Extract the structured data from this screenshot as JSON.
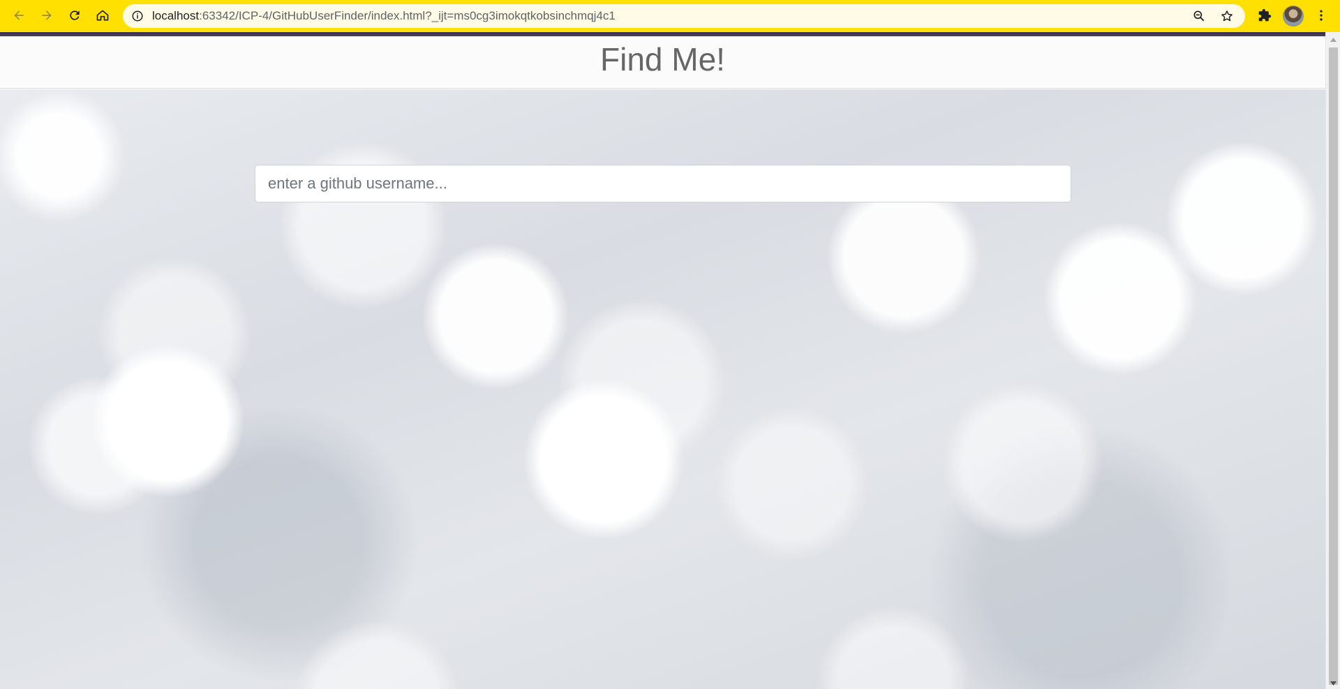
{
  "browser": {
    "url_host": "localhost",
    "url_rest": ":63342/ICP-4/GitHubUserFinder/index.html?_ijt=ms0cg3imokqtkobsinchmqj4c1",
    "toolbar_color": "#ffe000"
  },
  "page": {
    "brand": "Find Me!",
    "search": {
      "placeholder": "enter a github username...",
      "value": ""
    }
  },
  "icons": {
    "back": "arrow-left-icon",
    "forward": "arrow-right-icon",
    "reload": "reload-icon",
    "home": "home-icon",
    "info": "info-icon",
    "zoom": "zoom-out-icon",
    "bookmark": "star-icon",
    "extensions": "puzzle-icon",
    "menu": "kebab-menu-icon"
  }
}
